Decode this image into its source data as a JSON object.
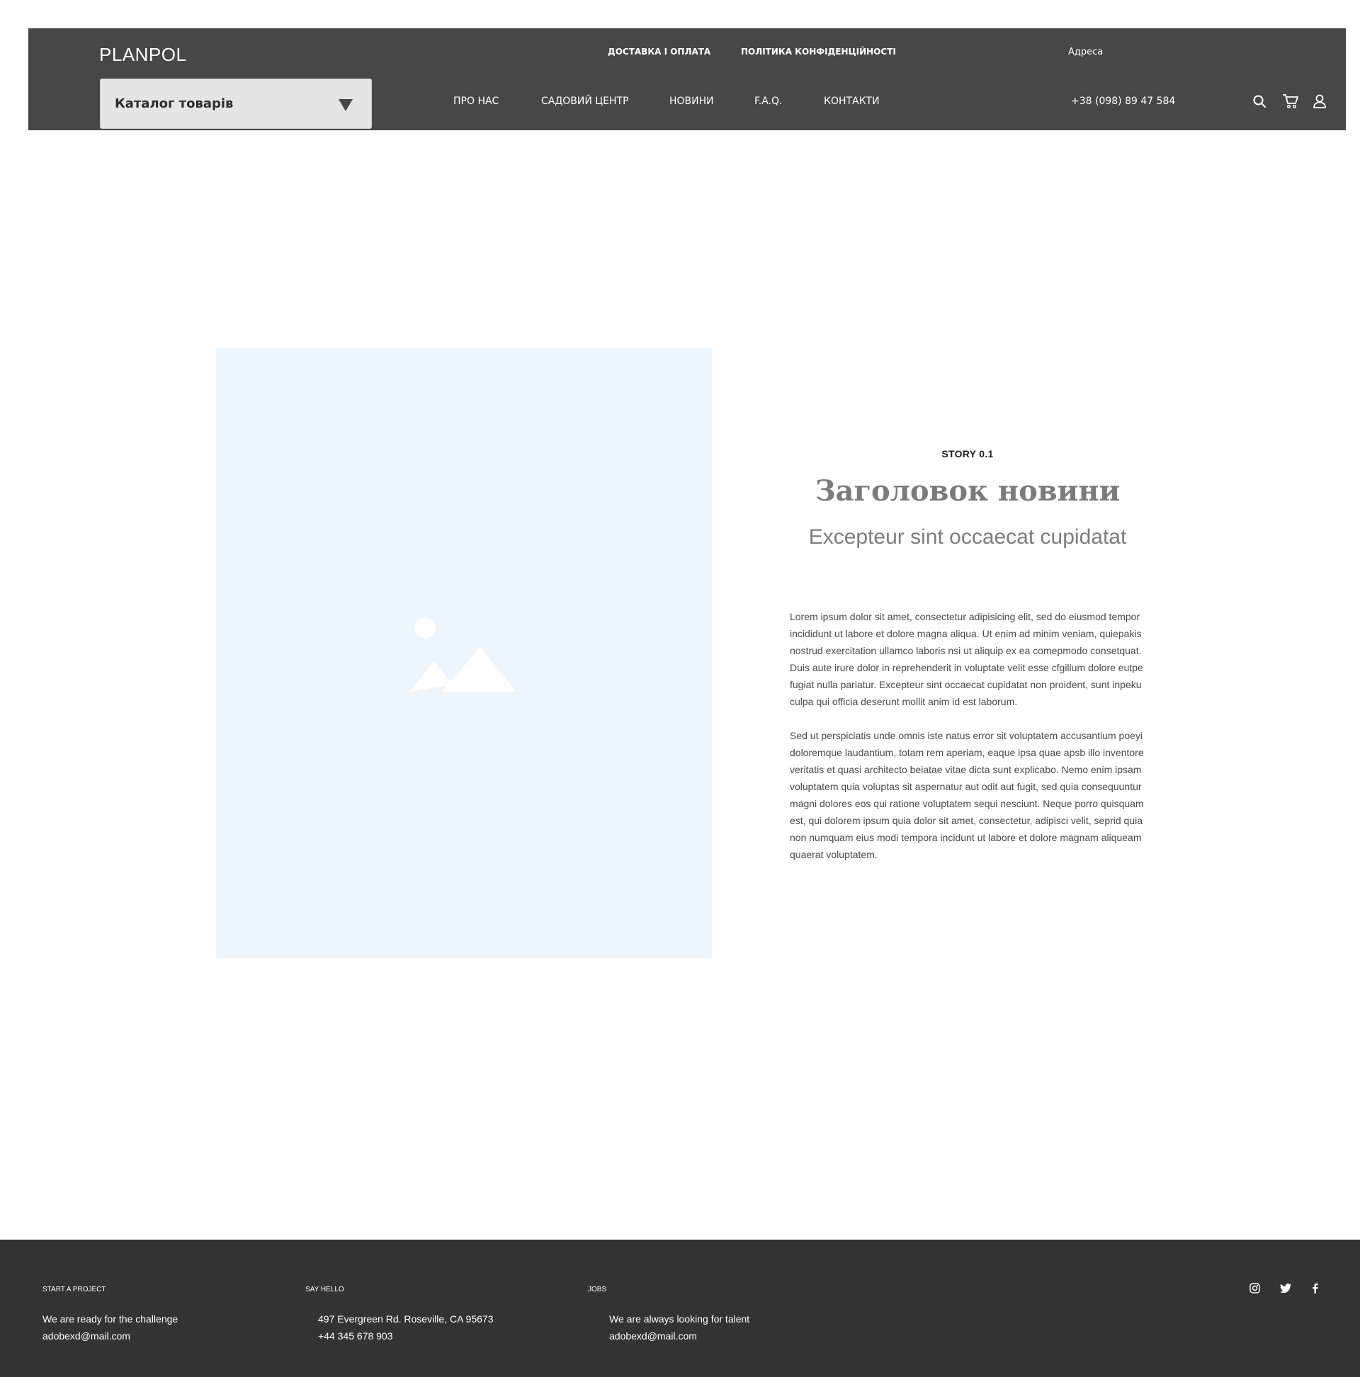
{
  "header": {
    "logo": "PLANPOL",
    "catalog_label": "Каталог товарів",
    "top_links": [
      "ДОСТАВКА І ОПЛАТА",
      "ПОЛІТИКА КОНФІДЕНЦІЙНОСТІ"
    ],
    "address_label": "Адреса",
    "nav": [
      "ПРО НАС",
      "САДОВИЙ ЦЕНТР",
      "НОВИНИ",
      "F.A.Q.",
      "КОНТАКТИ"
    ],
    "phone": "+38 (098) 89 47 584",
    "icons": [
      "search-icon",
      "cart-icon",
      "user-icon"
    ]
  },
  "article": {
    "label": "STORY 0.1",
    "title": "Заголовок новини",
    "subtitle": "Excepteur sint occaecat cupidatat",
    "paragraph1": "Lorem ipsum dolor sit amet, consectetur adipisicing elit, sed do eiusmod tempor incididunt ut labore et dolore magna aliqua. Ut enim ad minim veniam, quiepakis nostrud exercitation ullamco laboris nsi ut aliquip ex ea comepmodo consetquat. Duis aute irure dolor in reprehenderit in voluptate velit esse cfgillum dolore eutpe fugiat nulla pariatur. Excepteur sint occaecat cupidatat non proident, sunt inpeku culpa qui officia deserunt mollit anim id est laborum.",
    "paragraph2": "Sed ut perspiciatis unde omnis iste natus error sit voluptatem accusantium poeyi doloremque laudantium, totam rem aperiam, eaque ipsa quae apsb illo inventore veritatis et quasi architecto beiatae vitae dicta sunt explicabo. Nemo enim ipsam voluptatem quia voluptas sit aspernatur aut odit aut fugit, sed quia consequuntur magni dolores eos qui ratione voluptatem sequi nesciunt. Neque porro quisquam est, qui dolorem ipsum quia dolor sit amet, consectetur, adipisci velit, seprid quia non numquam eius modi tempora incidunt ut labore et dolore magnam aliqueam quaerat voluptatem.",
    "image_icon": "image-placeholder-icon"
  },
  "footer": {
    "columns": [
      {
        "heading": "START A PROJECT",
        "line1": "We are ready for the challenge",
        "line2": "adobexd@mail.com"
      },
      {
        "heading": "SAY HELLO",
        "line1": "497 Evergreen Rd. Roseville, CA 95673",
        "line2": "+44 345 678 903"
      },
      {
        "heading": "JOBS",
        "line1": "We are always looking for talent",
        "line2": "adobexd@mail.com"
      }
    ],
    "social": [
      "instagram-icon",
      "twitter-icon",
      "facebook-icon"
    ]
  },
  "colors": {
    "header_bg": "#474747",
    "footer_bg": "#333333",
    "image_placeholder_bg": "#eef6fd",
    "catalog_bg": "#e5e5e5"
  }
}
